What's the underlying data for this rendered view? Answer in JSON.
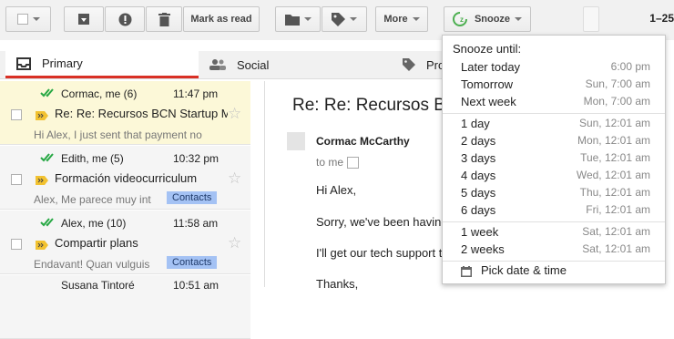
{
  "toolbar": {
    "mark_as_read": "Mark as read",
    "more": "More",
    "snooze": "Snooze",
    "page_count": "1–25",
    "snooze_accent": "#4caf50"
  },
  "tabs": [
    {
      "label": "Primary",
      "icon": "inbox-icon"
    },
    {
      "label": "Social",
      "icon": "people-icon"
    },
    {
      "label": "Pro",
      "icon": "tag-icon"
    }
  ],
  "emails": [
    {
      "senders": "Cormac, me (6)",
      "time": "11:47 pm",
      "subject": "Re: Re: Recursos BCN Startup M",
      "snippet": "Hi Alex, I just sent that payment no",
      "label": ""
    },
    {
      "senders": "Edith, me (5)",
      "time": "10:32 pm",
      "subject": "Formación videocurriculum",
      "snippet": "Alex, Me parece muy int",
      "label": "Contacts"
    },
    {
      "senders": "Alex, me (10)",
      "time": "11:58 am",
      "subject": "Compartir plans",
      "snippet": "Endavant! Quan vulguis",
      "label": "Contacts"
    },
    {
      "senders": "Susana Tintoré",
      "time": "10:51 am"
    }
  ],
  "reading": {
    "subject": "Re: Re: Recursos BC",
    "from": "Cormac McCarthy",
    "to": "to me",
    "lines": [
      "Hi Alex,",
      "Sorry, we've been having",
      "I'll get our tech support te",
      "Thanks,"
    ]
  },
  "snooze_menu": {
    "title": "Snooze until:",
    "groups": [
      [
        {
          "label": "Later today",
          "when": "6:00 pm"
        },
        {
          "label": "Tomorrow",
          "when": "Sun, 7:00 am"
        },
        {
          "label": "Next week",
          "when": "Mon, 7:00 am"
        }
      ],
      [
        {
          "label": "1 day",
          "when": "Sun, 12:01 am"
        },
        {
          "label": "2 days",
          "when": "Mon, 12:01 am"
        },
        {
          "label": "3 days",
          "when": "Tue, 12:01 am"
        },
        {
          "label": "4 days",
          "when": "Wed, 12:01 am"
        },
        {
          "label": "5 days",
          "when": "Thu, 12:01 am"
        },
        {
          "label": "6 days",
          "when": "Fri, 12:01 am"
        }
      ],
      [
        {
          "label": "1 week",
          "when": "Sat, 12:01 am"
        },
        {
          "label": "2 weeks",
          "when": "Sat, 12:01 am"
        }
      ]
    ],
    "pick_label": "Pick date & time"
  }
}
